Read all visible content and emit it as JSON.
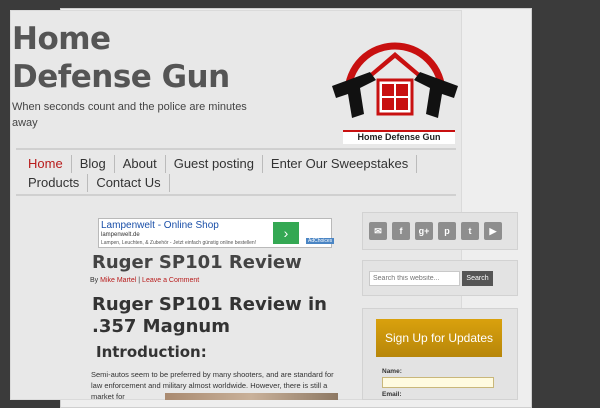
{
  "site": {
    "title": "Home Defense Gun",
    "description": "When seconds count and the police are minutes away",
    "logo_text": "Home Defense Gun"
  },
  "nav": {
    "items": [
      {
        "label": "Home",
        "active": true
      },
      {
        "label": "Blog",
        "active": false
      },
      {
        "label": "About",
        "active": false
      },
      {
        "label": "Guest posting",
        "active": false
      },
      {
        "label": "Enter Our Sweepstakes",
        "active": false
      },
      {
        "label": "Products",
        "active": false
      },
      {
        "label": "Contact Us",
        "active": false
      }
    ]
  },
  "ad": {
    "title": "Lampenwelt - Online Shop",
    "url": "lampenwelt.de",
    "description": "Lampen, Leuchten, & Zubehör - Jetzt einfach günstig online bestellen!",
    "choices": "AdChoices",
    "arrow": "›"
  },
  "post": {
    "title": "Ruger SP101 Review",
    "by_label": "By",
    "author": "Mike Martel",
    "comment_link": "Leave a Comment",
    "heading": "Ruger SP101 Review in .357 Magnum",
    "subheading": "Introduction:",
    "body": "Semi-autos seem to be preferred by many shooters, and are standard for law enforcement and military almost worldwide. However, there is still a market for"
  },
  "sidebar": {
    "social_icons": [
      {
        "icon": "email-icon",
        "glyph": "✉"
      },
      {
        "icon": "facebook-icon",
        "glyph": "f"
      },
      {
        "icon": "google-plus-icon",
        "glyph": "g+"
      },
      {
        "icon": "pinterest-icon",
        "glyph": "p"
      },
      {
        "icon": "twitter-icon",
        "glyph": "t"
      },
      {
        "icon": "youtube-icon",
        "glyph": "▶"
      }
    ],
    "search": {
      "placeholder": "Search this website...",
      "button": "Search"
    },
    "signup": {
      "heading": "Sign Up for Updates",
      "name_label": "Name:",
      "email_label": "Email:"
    }
  },
  "colors": {
    "accent": "#b81c1c",
    "signup_gold": "#c8930b",
    "background": "#3b3b3b"
  }
}
